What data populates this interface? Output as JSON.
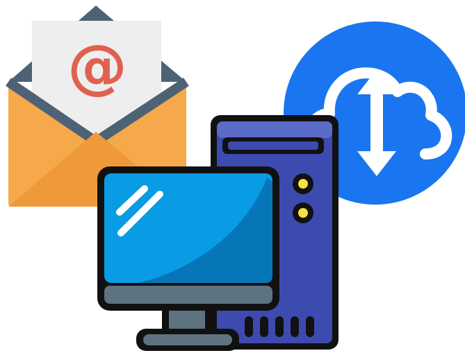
{
  "scene": {
    "icons": [
      {
        "name": "envelope-email-icon",
        "symbol": "@"
      },
      {
        "name": "cloud-upload-download-icon"
      },
      {
        "name": "desktop-computer-icon"
      }
    ]
  },
  "colors": {
    "background": "#ffffff",
    "envelope_orange": "#F5A94A",
    "envelope_dark_orange": "#EE9A3A",
    "envelope_slate": "#4E6275",
    "letter_paper": "#EEEEEE",
    "at_symbol_red": "#E06150",
    "cloud_circle_blue": "#1A75F0",
    "cloud_white": "#FFFFFF",
    "tower_blue": "#3D4BB0",
    "tower_purple": "#5A6CC8",
    "led_yellow": "#F5E23A",
    "screen_blue": "#0A9BE5",
    "screen_dark_blue": "#0676B8",
    "monitor_outline": "#111111",
    "stand_gray": "#5E7380"
  }
}
